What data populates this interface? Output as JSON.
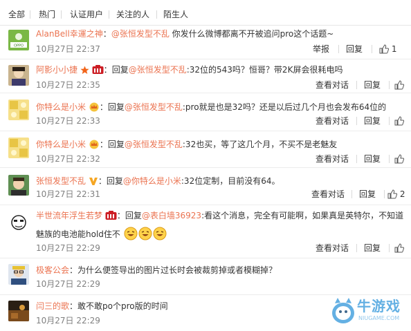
{
  "tabs": [
    "全部",
    "热门",
    "认证用户",
    "关注的人",
    "陌生人"
  ],
  "actions": {
    "report": "举报",
    "reply": "回复",
    "view_conversation": "查看对话"
  },
  "comments": [
    {
      "user": "AlanBell幸運之神",
      "sep": "：",
      "mention": "@张恒发型不乱",
      "text": " 你发什么微博都离不开被追问pro这个话题~",
      "time": "10月27日 22:37",
      "likes": "1"
    },
    {
      "user": "阿影小小捷",
      "sep": "：",
      "reply_prefix": "回复",
      "mention": "@张恒发型不乱",
      "text": ":32位的543吗？恒哥？带2K屏会很耗电吗",
      "time": "10月27日 22:35"
    },
    {
      "user": "你特么是小米",
      "sep": "：",
      "reply_prefix": "回复",
      "mention": "@张恒发型不乱",
      "text": ":pro就是也是32吗？还是以后过几个月也会发布64位的",
      "time": "10月27日 22:33"
    },
    {
      "user": "你特么是小米",
      "sep": "：",
      "reply_prefix": "回复",
      "mention": "@张恒发型不乱",
      "text": ":32也买，等了这几个月，不买不是老魅友",
      "time": "10月27日 22:32"
    },
    {
      "user": "张恒发型不乱",
      "sep": "：",
      "reply_prefix": "回复",
      "mention": "@你特么是小米",
      "text": ":32位定制，目前没有64。",
      "time": "10月27日 22:31",
      "likes": "2"
    },
    {
      "user": "半世流年浮生若梦",
      "sep": "：",
      "reply_prefix": "回复",
      "mention": "@表白墙36923",
      "text": ":看这个消息，完全有可能啊，如果真是英特尔，不知道",
      "text2": "魅族的电池能hold住不",
      "time": "10月27日 22:29"
    },
    {
      "user": "极客公会",
      "sep": "：",
      "text": "为什么便签导出的图片过长时会被裁剪掉或者模糊掉？",
      "time": "10月27日 22:29"
    },
    {
      "user": "闫三的歌",
      "sep": "：",
      "text": "敢不敢po个pro版的时间",
      "time": "10月27日 22:29"
    }
  ],
  "watermark": {
    "title": "牛游戏",
    "sub": "NIUGAME.COM"
  },
  "colors": {
    "name": "#eb7350",
    "text": "#333333",
    "time": "#808080",
    "vip_crown": "#f27c1e"
  }
}
